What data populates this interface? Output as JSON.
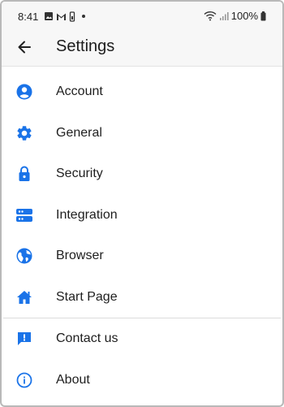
{
  "status_bar": {
    "time": "8:41",
    "battery": "100%",
    "icons": [
      "image-icon",
      "gmail-icon",
      "storage-icon",
      "dot-icon",
      "wifi-icon",
      "signal-icon",
      "battery-icon"
    ]
  },
  "header": {
    "title": "Settings",
    "back_icon": "arrow-left-icon"
  },
  "menu": {
    "group1": [
      {
        "label": "Account",
        "icon": "account-icon"
      },
      {
        "label": "General",
        "icon": "gear-icon"
      },
      {
        "label": "Security",
        "icon": "lock-icon"
      },
      {
        "label": "Integration",
        "icon": "server-icon"
      },
      {
        "label": "Browser",
        "icon": "globe-icon"
      },
      {
        "label": "Start Page",
        "icon": "home-icon"
      }
    ],
    "group2": [
      {
        "label": "Contact us",
        "icon": "feedback-icon"
      },
      {
        "label": "About",
        "icon": "info-icon"
      }
    ]
  },
  "colors": {
    "accent": "#1a73e8",
    "header_bg": "#f7f7f7",
    "divider": "#dcdcdc"
  }
}
